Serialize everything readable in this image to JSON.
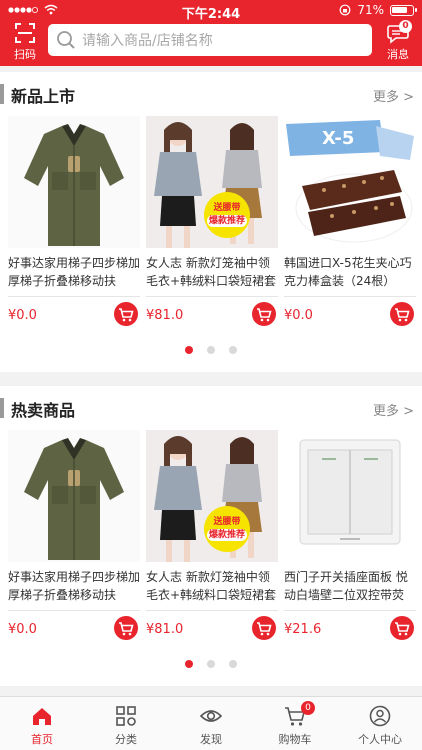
{
  "status": {
    "time": "下午2:44",
    "battery": "71%"
  },
  "header": {
    "scan_label": "扫码",
    "search_placeholder": "请输入商品/店铺名称",
    "message_label": "消息",
    "message_count": "0"
  },
  "sections": [
    {
      "title": "新品上市",
      "more": "更多 >",
      "products": [
        {
          "name": "好事达家用梯子四步梯加厚梯子折叠梯移动扶",
          "price": "¥0.0",
          "image": "olive-shirt"
        },
        {
          "name": "女人志 新款灯笼袖中领毛衣+韩绒料口袋短裙套",
          "price": "¥81.0",
          "image": "fashion-outfit",
          "tag_line1": "送腰带",
          "tag_line2": "爆款推荐"
        },
        {
          "name": "韩国进口X-5花生夹心巧克力棒盒装（24根）",
          "price": "¥0.0",
          "image": "chocolate-bar"
        }
      ]
    },
    {
      "title": "热卖商品",
      "more": "更多 >",
      "products": [
        {
          "name": "好事达家用梯子四步梯加厚梯子折叠梯移动扶",
          "price": "¥0.0",
          "image": "olive-shirt"
        },
        {
          "name": "女人志 新款灯笼袖中领毛衣+韩绒料口袋短裙套",
          "price": "¥81.0",
          "image": "fashion-outfit",
          "tag_line1": "送腰带",
          "tag_line2": "爆款推荐"
        },
        {
          "name": "西门子开关插座面板 悦动白墙壁二位双控带荧",
          "price": "¥21.6",
          "image": "wall-switch"
        }
      ]
    }
  ],
  "tabs": [
    {
      "label": "首页",
      "icon": "home-icon",
      "active": true
    },
    {
      "label": "分类",
      "icon": "category-icon"
    },
    {
      "label": "发现",
      "icon": "eye-icon"
    },
    {
      "label": "购物车",
      "icon": "cart-icon",
      "badge": "0"
    },
    {
      "label": "个人中心",
      "icon": "user-icon"
    }
  ],
  "colors": {
    "brand": "#e8242d"
  }
}
